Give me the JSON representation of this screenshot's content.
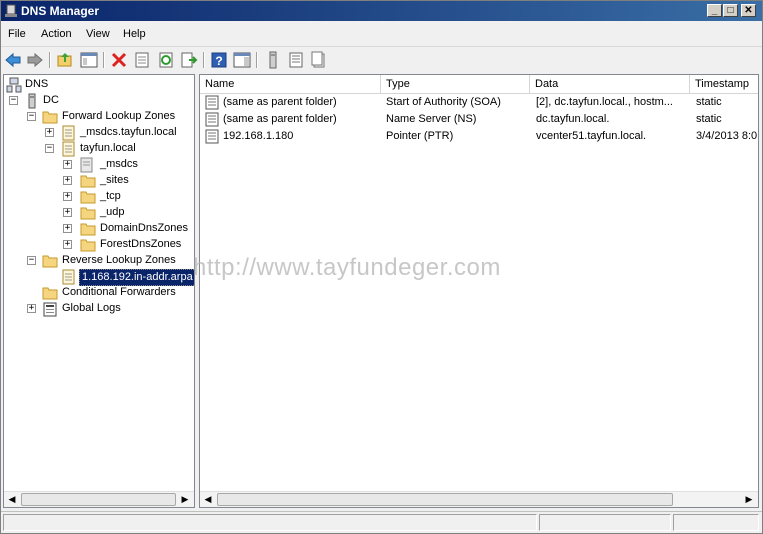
{
  "window": {
    "title": "DNS Manager",
    "controls": {
      "minimize": "_",
      "maximize": "□",
      "close": "✕"
    }
  },
  "menu": [
    "File",
    "Action",
    "View",
    "Help"
  ],
  "toolbar": {
    "icons": [
      "back-arrow-icon",
      "forward-arrow-icon",
      "up-folder-icon",
      "show-hide-console-tree-icon",
      "delete-icon",
      "properties-icon",
      "refresh-icon",
      "export-list-icon",
      "help-icon",
      "action-pane-icon",
      "server-icon",
      "record-icon",
      "zone-icon"
    ]
  },
  "tree": {
    "root": "DNS",
    "server": "DC",
    "forward_zones": "Forward Lookup Zones",
    "msdcs_zone": "_msdcs.tayfun.local",
    "tayfun_zone": "tayfun.local",
    "tayfun_children": [
      "_msdcs",
      "_sites",
      "_tcp",
      "_udp",
      "DomainDnsZones",
      "ForestDnsZones"
    ],
    "reverse_zones": "Reverse Lookup Zones",
    "reverse_zone_item": "1.168.192.in-addr.arpa",
    "conditional_forwarders": "Conditional Forwarders",
    "global_logs": "Global Logs"
  },
  "list": {
    "columns": [
      "Name",
      "Type",
      "Data",
      "Timestamp"
    ],
    "rows": [
      {
        "name": "(same as parent folder)",
        "type": "Start of Authority (SOA)",
        "data": "[2], dc.tayfun.local., hostm...",
        "timestamp": "static"
      },
      {
        "name": "(same as parent folder)",
        "type": "Name Server (NS)",
        "data": "dc.tayfun.local.",
        "timestamp": "static"
      },
      {
        "name": "192.168.1.180",
        "type": "Pointer (PTR)",
        "data": "vcenter51.tayfun.local.",
        "timestamp": "3/4/2013 8:0"
      }
    ]
  },
  "watermark": "http://www.tayfundeger.com",
  "colors": {
    "titlebar_start": "#0a246a",
    "titlebar_end": "#3a6ea5",
    "selection": "#0a246a",
    "folder": "#f5d580"
  }
}
